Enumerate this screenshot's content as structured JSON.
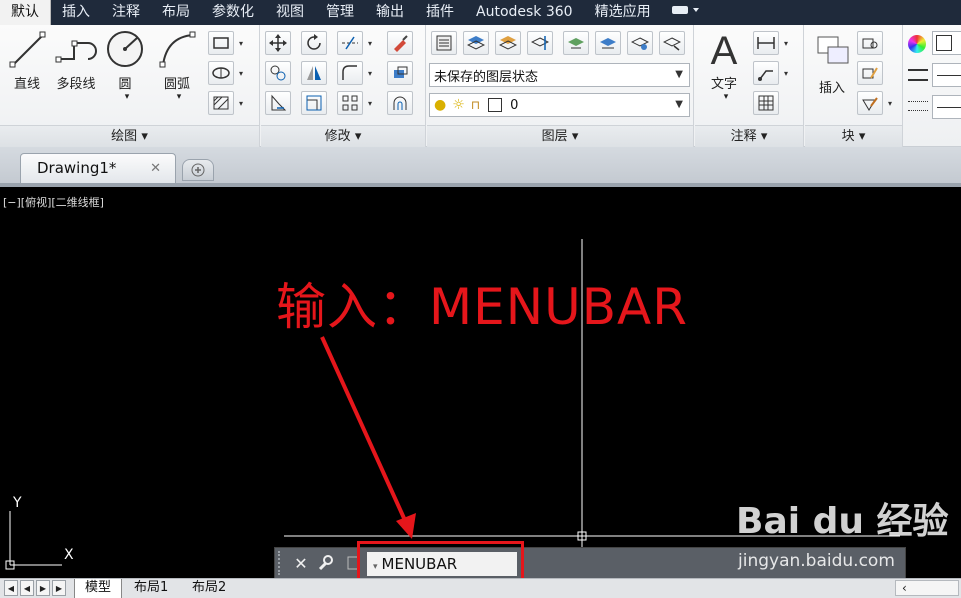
{
  "menu_tabs": [
    "默认",
    "插入",
    "注释",
    "布局",
    "参数化",
    "视图",
    "管理",
    "输出",
    "插件",
    "Autodesk 360",
    "精选应用"
  ],
  "draw_panel": {
    "title": "绘图",
    "tools": [
      "直线",
      "多段线",
      "圆",
      "圆弧"
    ]
  },
  "modify_panel": {
    "title": "修改"
  },
  "layers_panel": {
    "title": "图层",
    "layer_state": "未保存的图层状态",
    "current_layer": "0"
  },
  "annotation_panel": {
    "title": "注释",
    "text_tool": "文字"
  },
  "block_panel": {
    "title": "块",
    "insert_tool": "插入"
  },
  "file_tab": {
    "name": "Drawing1*",
    "close": "✕"
  },
  "viewport_label": "[−][俯视][二维线框]",
  "annotation_text": "输入：MENUBAR",
  "command_line": {
    "value": "MENUBAR"
  },
  "layout_tabs": [
    "模型",
    "布局1",
    "布局2"
  ],
  "ucs": {
    "x": "X",
    "y": "Y"
  },
  "watermark": {
    "brand": "Bai du 经验",
    "url": "jingyan.baidu.com"
  },
  "colors": {
    "accent_red": "#e5161b",
    "tabbar": "#1f2a3b"
  }
}
